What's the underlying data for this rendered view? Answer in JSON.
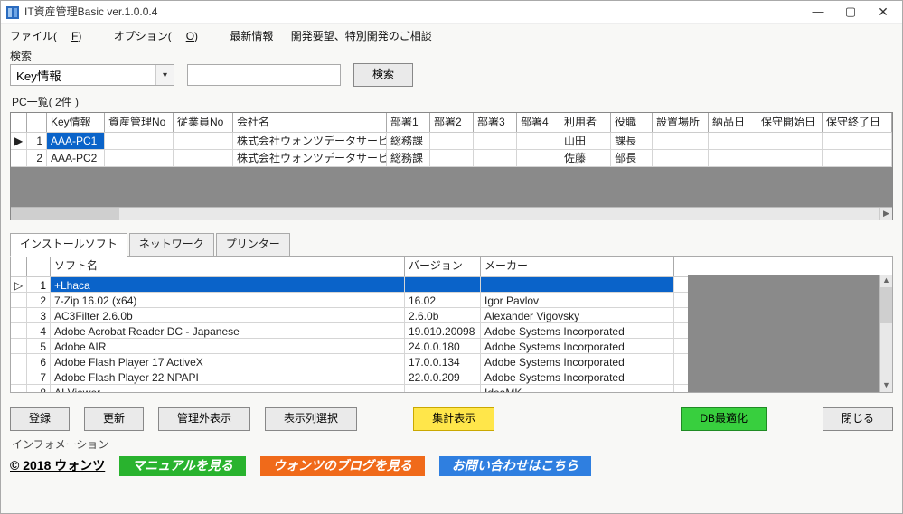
{
  "title": "IT資産管理Basic ver.1.0.0.4",
  "menu": {
    "file": "ファイル(",
    "file_u": "F",
    "file2": ")",
    "opt": "オプション(",
    "opt_u": "O",
    "opt2": ")",
    "latest": "最新情報",
    "req": "開発要望、特別開発のご相談"
  },
  "search": {
    "label": "検索",
    "combo": "Key情報",
    "btn": "検索"
  },
  "pclist_label": "PC一覧( 2件 )",
  "pc_headers": {
    "mark": "",
    "idx": "",
    "key": "Key情報",
    "asset": "資産管理No",
    "emp": "従業員No",
    "company": "会社名",
    "dept1": "部署1",
    "dept2": "部署2",
    "dept3": "部署3",
    "dept4": "部署4",
    "user": "利用者",
    "role": "役職",
    "place": "設置場所",
    "deliv": "納品日",
    "mstart": "保守開始日",
    "mend": "保守終了日"
  },
  "pc_rows": [
    {
      "mark": "▶",
      "idx": "1",
      "key": "AAA-PC1",
      "asset": "",
      "emp": "",
      "company": "株式会社ウォンツデータサービス",
      "dept1": "総務課",
      "dept2": "",
      "dept3": "",
      "dept4": "",
      "user": "山田",
      "role": "課長",
      "place": "",
      "deliv": "",
      "mstart": "",
      "mend": ""
    },
    {
      "mark": "",
      "idx": "2",
      "key": "AAA-PC2",
      "asset": "",
      "emp": "",
      "company": "株式会社ウォンツデータサービス",
      "dept1": "総務課",
      "dept2": "",
      "dept3": "",
      "dept4": "",
      "user": "佐藤",
      "role": "部長",
      "place": "",
      "deliv": "",
      "mstart": "",
      "mend": ""
    }
  ],
  "tabs": {
    "soft": "インストールソフト",
    "net": "ネットワーク",
    "prn": "プリンター"
  },
  "sw_headers": {
    "mark": "",
    "idx": "",
    "name": "ソフト名",
    "sub": "",
    "ver": "バージョン",
    "maker": "メーカー"
  },
  "sw_rows": [
    {
      "mark": "▷",
      "idx": "1",
      "name": "+Lhaca",
      "ver": "",
      "maker": ""
    },
    {
      "mark": "",
      "idx": "2",
      "name": "7-Zip 16.02 (x64)",
      "ver": "16.02",
      "maker": "Igor Pavlov"
    },
    {
      "mark": "",
      "idx": "3",
      "name": "AC3Filter 2.6.0b",
      "ver": "2.6.0b",
      "maker": "Alexander Vigovsky"
    },
    {
      "mark": "",
      "idx": "4",
      "name": "Adobe Acrobat Reader DC - Japanese",
      "ver": "19.010.20098",
      "maker": "Adobe Systems Incorporated"
    },
    {
      "mark": "",
      "idx": "5",
      "name": "Adobe AIR",
      "ver": "24.0.0.180",
      "maker": "Adobe Systems Incorporated"
    },
    {
      "mark": "",
      "idx": "6",
      "name": "Adobe Flash Player 17 ActiveX",
      "ver": "17.0.0.134",
      "maker": "Adobe Systems Incorporated"
    },
    {
      "mark": "",
      "idx": "7",
      "name": "Adobe Flash Player 22 NPAPI",
      "ver": "22.0.0.209",
      "maker": "Adobe Systems Incorporated"
    },
    {
      "mark": "",
      "idx": "8",
      "name": "AI Viewer",
      "ver": "",
      "maker": "IdeaMK"
    }
  ],
  "buttons": {
    "reg": "登録",
    "upd": "更新",
    "excl": "管理外表示",
    "colsel": "表示列選択",
    "agg": "集計表示",
    "dbopt": "DB最適化",
    "close": "閉じる"
  },
  "footer": {
    "info": "インフォメーション",
    "copy": "© 2018 ウォンツ",
    "manual": "マニュアルを見る",
    "blog": "ウォンツのブログを見る",
    "contact": "お問い合わせはこちら"
  }
}
